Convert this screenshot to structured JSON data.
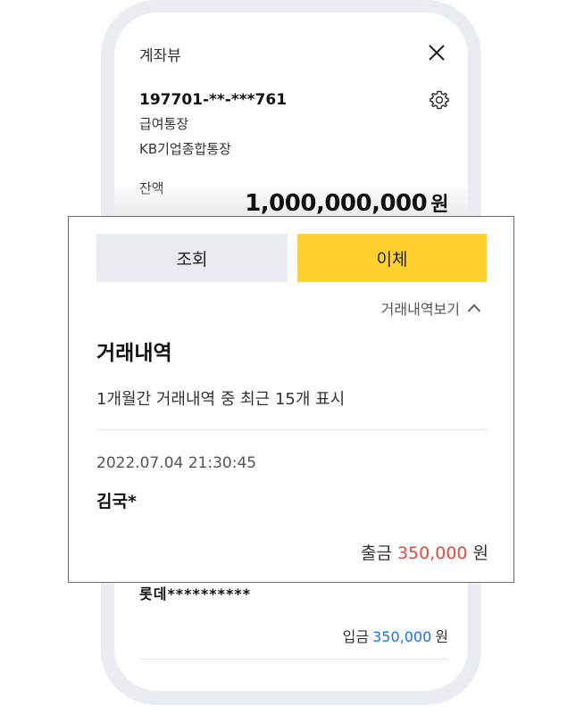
{
  "account_view": {
    "title": "계좌뷰",
    "account_number": "197701-**-***761",
    "account_type": "급여통장",
    "product_name": "KB기업종합통장",
    "balance_label": "잔액",
    "balance_amount": "1,000,000,000",
    "balance_unit": "원",
    "background_tx": {
      "name": "롯데**********",
      "type": "입금",
      "amount": "350,000",
      "unit": "원"
    }
  },
  "actions": {
    "inquiry_label": "조회",
    "transfer_label": "이체"
  },
  "history": {
    "toggle_label": "거래내역보기",
    "title": "거래내역",
    "description": "1개월간 거래내역 중 최근 15개 표시",
    "transaction": {
      "datetime": "2022.07.04  21:30:45",
      "name": "김국*",
      "type": "출금",
      "amount": "350,000",
      "unit": "원"
    }
  },
  "colors": {
    "transfer_button": "#ffd02e",
    "inquiry_button": "#e8ebef",
    "withdrawal_amount": "#e8453c",
    "deposit_amount": "#1d6fe0",
    "phone_frame": "#e9edf1"
  },
  "icons": [
    "close-icon",
    "gear-icon",
    "chevron-up-icon"
  ]
}
